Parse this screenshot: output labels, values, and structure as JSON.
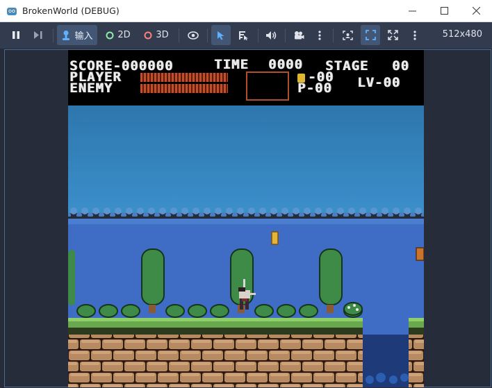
{
  "window": {
    "title": "BrokenWorld (DEBUG)",
    "controls": [
      "minimize-icon",
      "maximize-icon",
      "close-icon"
    ]
  },
  "toolbar": {
    "input_label": "输入",
    "mode_2d": "2D",
    "mode_3d": "3D",
    "resolution": "512x480",
    "accent_color": "#5fb1ff",
    "dot_2d_color": "#8eeca8",
    "dot_3d_color": "#fc7f7f"
  },
  "hud": {
    "score_label": "SCORE-000000",
    "time_label": "TIME",
    "time_value": "0000",
    "stage_label": "STAGE",
    "stage_value": "00",
    "player_label": "PLAYER",
    "enemy_label": "ENEMY",
    "hearts": "-00",
    "p_value": "P-00",
    "level": "LV-00"
  }
}
